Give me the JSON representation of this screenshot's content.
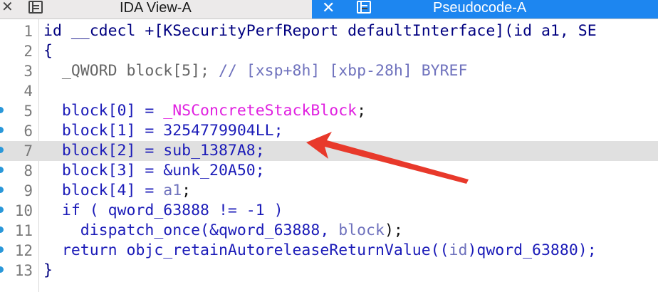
{
  "tabs": [
    {
      "label": "IDA View-A",
      "active": false
    },
    {
      "label": "Pseudocode-A",
      "active": true
    }
  ],
  "code_lines": [
    {
      "num": "1",
      "parts": [
        "id __cdecl +[KSecurityPerfReport defaultInterface](id a1, SE"
      ]
    },
    {
      "num": "2",
      "parts": [
        "{"
      ]
    },
    {
      "num": "3",
      "parts": [
        "  _QWORD block[5]; ",
        "// [xsp+8h] [xbp-28h] BYREF"
      ]
    },
    {
      "num": "4",
      "parts": [
        ""
      ]
    },
    {
      "num": "5",
      "parts": [
        "  block[0] = ",
        "_NSConcreteStackBlock",
        ";"
      ]
    },
    {
      "num": "6",
      "parts": [
        "  block[1] = 3254779904LL;"
      ]
    },
    {
      "num": "7",
      "parts": [
        "  block[2] = sub_1387A8;"
      ]
    },
    {
      "num": "8",
      "parts": [
        "  block[3] = &unk_20A50;"
      ]
    },
    {
      "num": "9",
      "parts": [
        "  block[4] = ",
        "a1",
        ";"
      ]
    },
    {
      "num": "10",
      "parts": [
        "  if ( qword_63888 != -1 )"
      ]
    },
    {
      "num": "11",
      "parts": [
        "    dispatch_once(&qword_63888, ",
        "block",
        ");"
      ]
    },
    {
      "num": "12",
      "parts": [
        "  return objc_retainAutoreleaseReturnValue((",
        "id",
        ")qword_63880);"
      ]
    },
    {
      "num": "13",
      "parts": [
        "}"
      ]
    }
  ],
  "colors": {
    "active_tab": "#1d86f0",
    "identifier": "#1b1bb8",
    "comment": "#6f72bd",
    "import_symbol": "#e020e0",
    "line_highlight": "#e0e0e0",
    "breakpoint_dot": "#2b98d9",
    "annotation_arrow": "#e8392b"
  }
}
